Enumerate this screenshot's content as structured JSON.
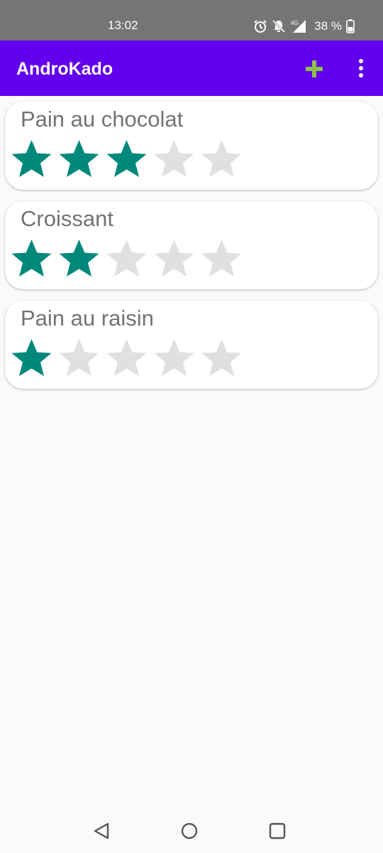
{
  "status_bar": {
    "time": "13:02",
    "battery_text": "38 %",
    "network": "4G",
    "icons": [
      "alarm-icon",
      "notifications-off-icon",
      "signal-4g-icon",
      "battery-icon"
    ]
  },
  "app_bar": {
    "title": "AndroKado",
    "actions": [
      "add-icon",
      "more-vert-icon"
    ],
    "add_icon_color": "#8bc34a"
  },
  "colors": {
    "primary": "#6200ee",
    "star_filled": "#00897b",
    "star_empty": "#e0e0e0"
  },
  "rating_max": 5,
  "items": [
    {
      "name": "Pain au chocolat",
      "rating": 3
    },
    {
      "name": "Croissant",
      "rating": 2
    },
    {
      "name": "Pain au raisin",
      "rating": 1
    }
  ],
  "nav_bar": {
    "buttons": [
      "back-icon",
      "home-icon",
      "recents-icon"
    ]
  }
}
